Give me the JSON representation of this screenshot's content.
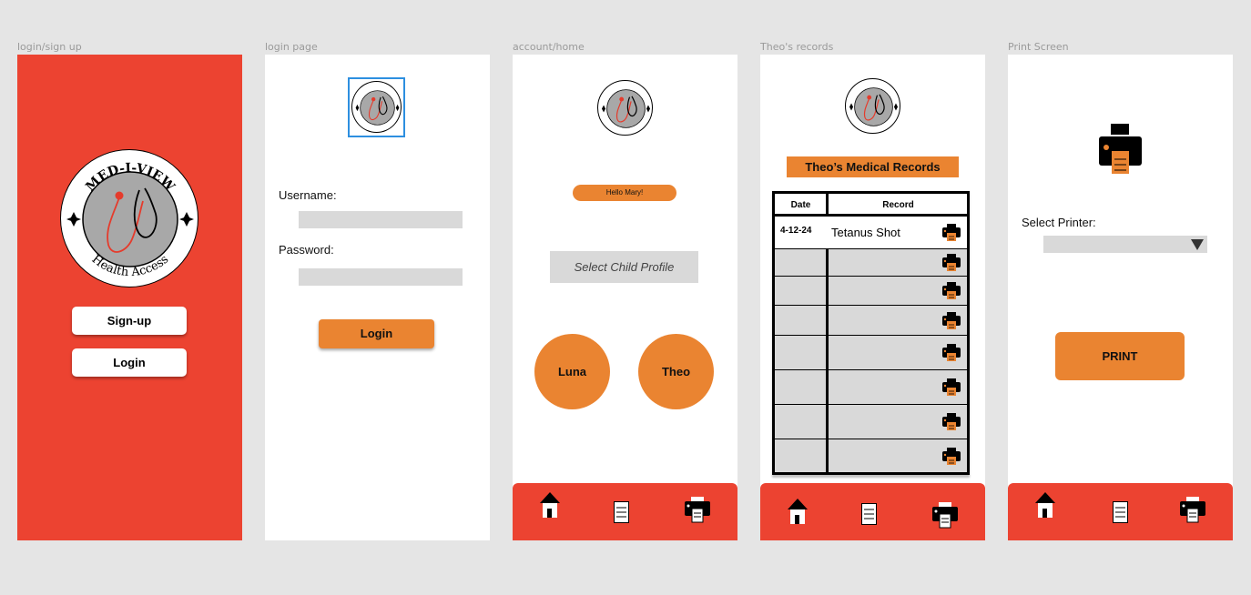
{
  "frames": {
    "signup": {
      "label": "login/sign up",
      "signup_button": "Sign-up",
      "login_button": "Login"
    },
    "login": {
      "label": "login page",
      "username_label": "Username:",
      "password_label": "Password:",
      "login_button": "Login"
    },
    "home": {
      "label": "account/home",
      "greeting": "Hello Mary!",
      "select_profile": "Select Child Profile",
      "children": [
        "Luna",
        "Theo"
      ]
    },
    "records": {
      "label": "Theo's records",
      "title": "Theo’s Medical Records",
      "col_date": "Date",
      "col_record": "Record",
      "rows": [
        {
          "date": "4-12-24",
          "record": "Tetanus Shot"
        },
        {
          "date": "",
          "record": ""
        },
        {
          "date": "",
          "record": ""
        },
        {
          "date": "",
          "record": ""
        },
        {
          "date": "",
          "record": ""
        },
        {
          "date": "",
          "record": ""
        },
        {
          "date": "",
          "record": ""
        },
        {
          "date": "",
          "record": ""
        }
      ]
    },
    "print": {
      "label": "Print Screen",
      "select_printer_label": "Select Printer:",
      "print_button": "PRINT"
    }
  },
  "logo": {
    "top_text": "MED-I-VIEW",
    "bottom_text": "Health Access"
  },
  "nav": [
    "home-icon",
    "document-icon",
    "printer-icon"
  ],
  "colors": {
    "brand_red": "#ec4331",
    "accent_orange": "#ea8431",
    "field_gray": "#d9d9d9"
  }
}
